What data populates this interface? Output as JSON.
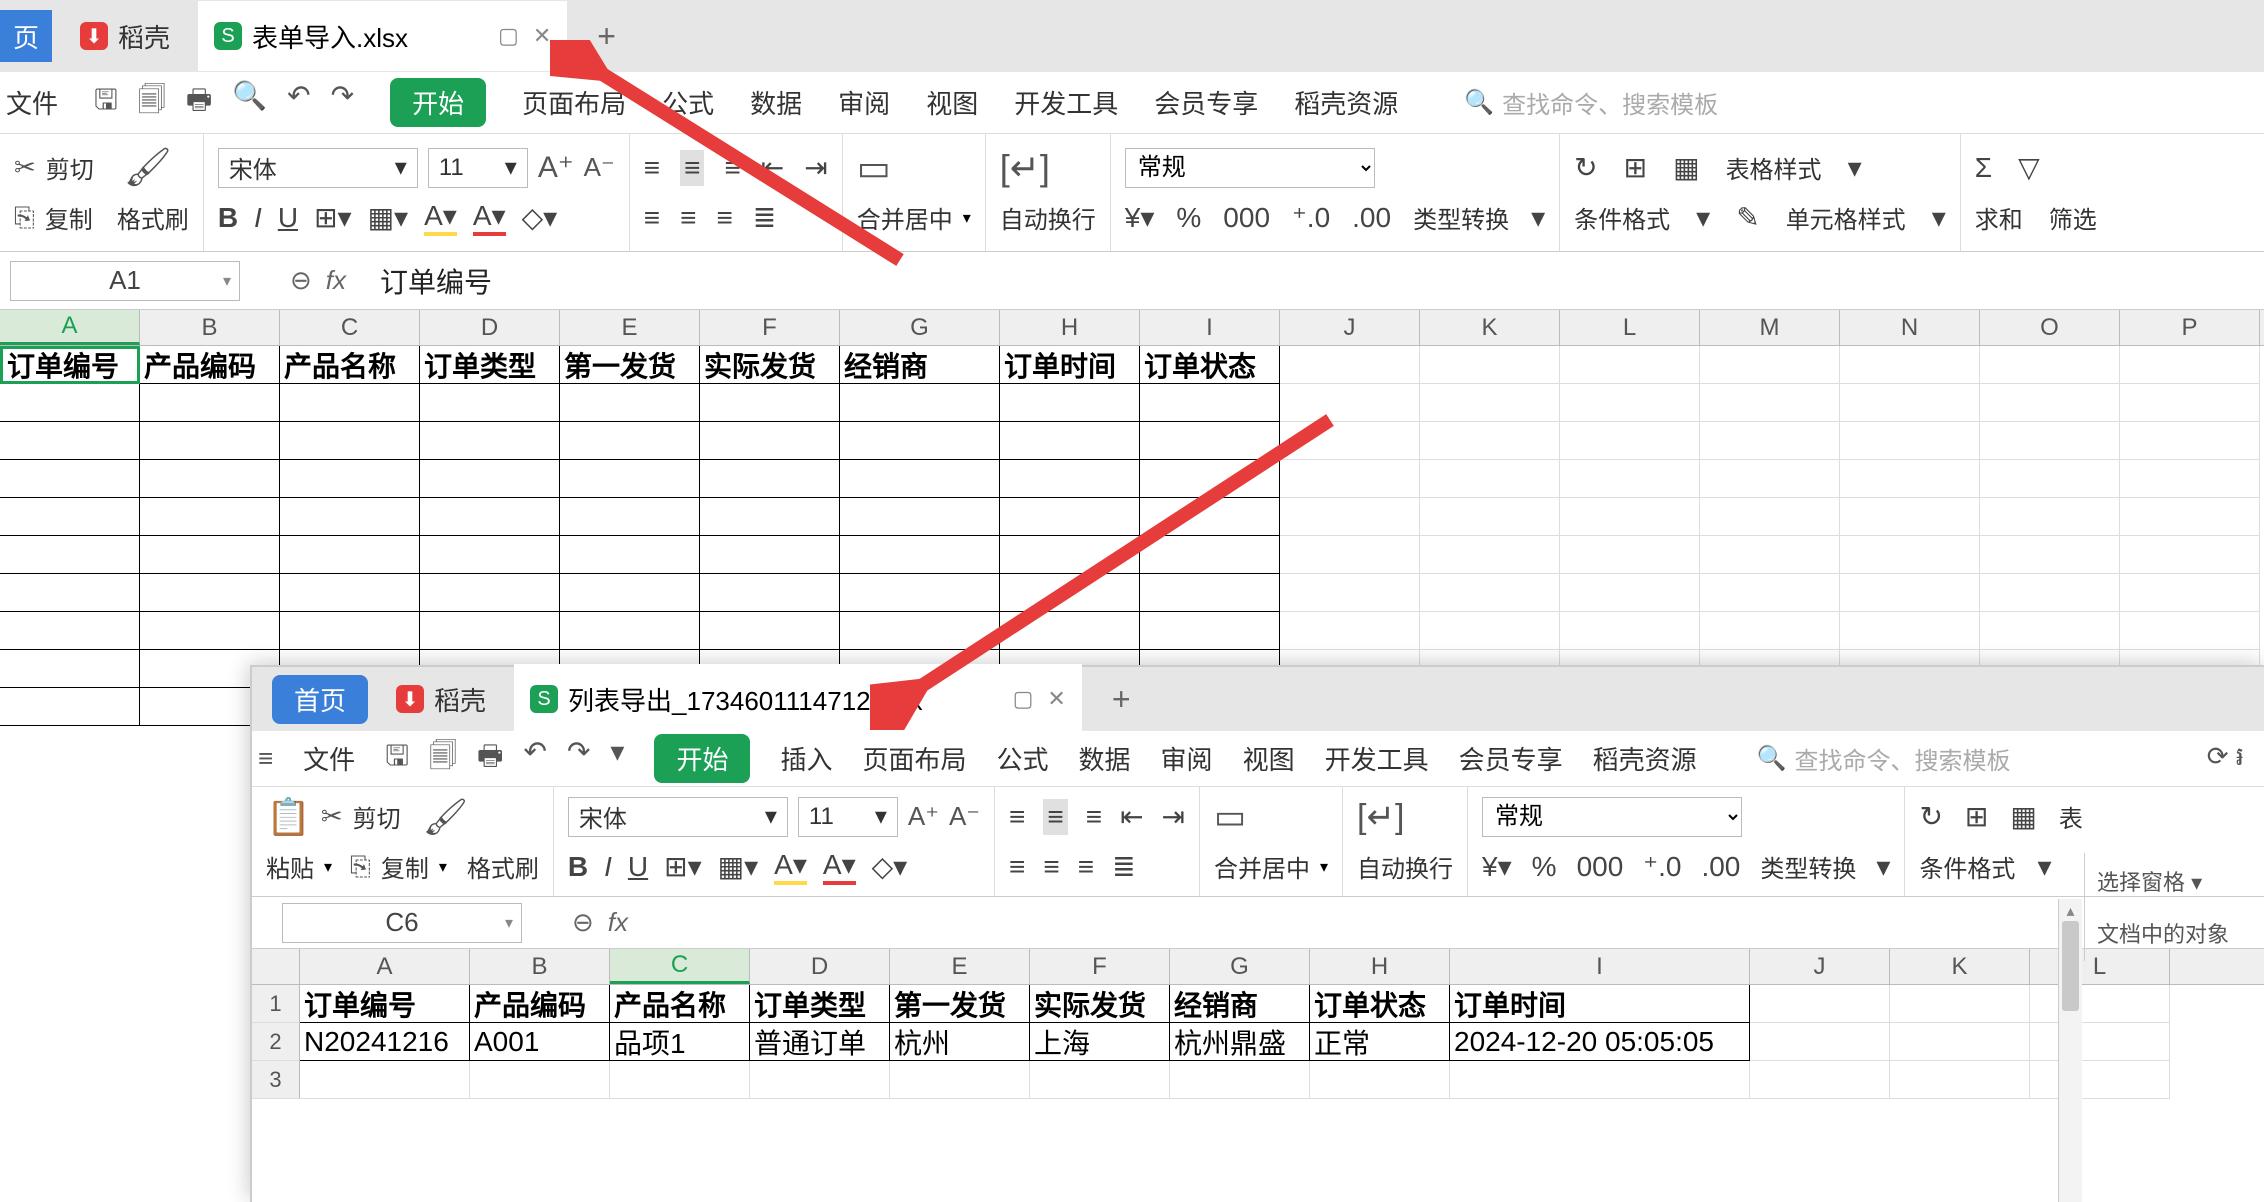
{
  "top": {
    "tabs": {
      "home": "页",
      "docke": "稻壳",
      "file": "表单导入.xlsx",
      "plus": "+"
    },
    "menu": {
      "file": "文件",
      "start": "开始",
      "items": [
        "页面布局",
        "公式",
        "数据",
        "审阅",
        "视图",
        "开发工具",
        "会员专享",
        "稻壳资源"
      ],
      "search_ph": "查找命令、搜索模板"
    },
    "ribbon": {
      "cut": "剪切",
      "copy": "复制",
      "fmt": "格式刷",
      "font_name": "宋体",
      "font_size": "11",
      "merge": "合并居中",
      "wrap": "自动换行",
      "nfmt": "常规",
      "typeconv": "类型转换",
      "condfmt": "条件格式",
      "tblfmt": "表格样式",
      "cellfmt": "单元格样式",
      "sum": "求和",
      "filter": "筛选"
    },
    "namebox": "A1",
    "formula": "订单编号",
    "cols": [
      "A",
      "B",
      "C",
      "D",
      "E",
      "F",
      "G",
      "H",
      "I",
      "J",
      "K",
      "L",
      "M",
      "N",
      "O",
      "P"
    ],
    "headers": [
      "订单编号",
      "产品编码",
      "产品名称",
      "订单类型",
      "第一发货",
      "实际发货",
      "经销商",
      "订单时间",
      "订单状态"
    ]
  },
  "bot": {
    "tabs": {
      "home": "首页",
      "docke": "稻壳",
      "file": "列表导出_1734601114712.xlsx"
    },
    "menu": {
      "file": "文件",
      "start": "开始",
      "items": [
        "插入",
        "页面布局",
        "公式",
        "数据",
        "审阅",
        "视图",
        "开发工具",
        "会员专享",
        "稻壳资源"
      ],
      "search_ph": "查找命令、搜索模板"
    },
    "ribbon": {
      "paste": "粘贴",
      "cut": "剪切",
      "copy": "复制",
      "fmt": "格式刷",
      "font_name": "宋体",
      "font_size": "11",
      "merge": "合并居中",
      "wrap": "自动换行",
      "nfmt": "常规",
      "typeconv": "类型转换",
      "condfmt": "条件格式",
      "tblfmt": "表"
    },
    "namebox": "C6",
    "side": {
      "sel": "选择窗格",
      "obj": "文档中的对象"
    },
    "cols": [
      "A",
      "B",
      "C",
      "D",
      "E",
      "F",
      "G",
      "H",
      "I",
      "J",
      "K",
      "L"
    ],
    "rows": [
      "1",
      "2",
      "3"
    ],
    "headers": [
      "订单编号",
      "产品编码",
      "产品名称",
      "订单类型",
      "第一发货",
      "实际发货",
      "经销商",
      "订单状态",
      "订单时间"
    ],
    "data_row": [
      "N20241216",
      "A001",
      "品项1",
      "普通订单",
      "杭州",
      "上海",
      "杭州鼎盛",
      "正常",
      "2024-12-20 05:05:05"
    ]
  }
}
